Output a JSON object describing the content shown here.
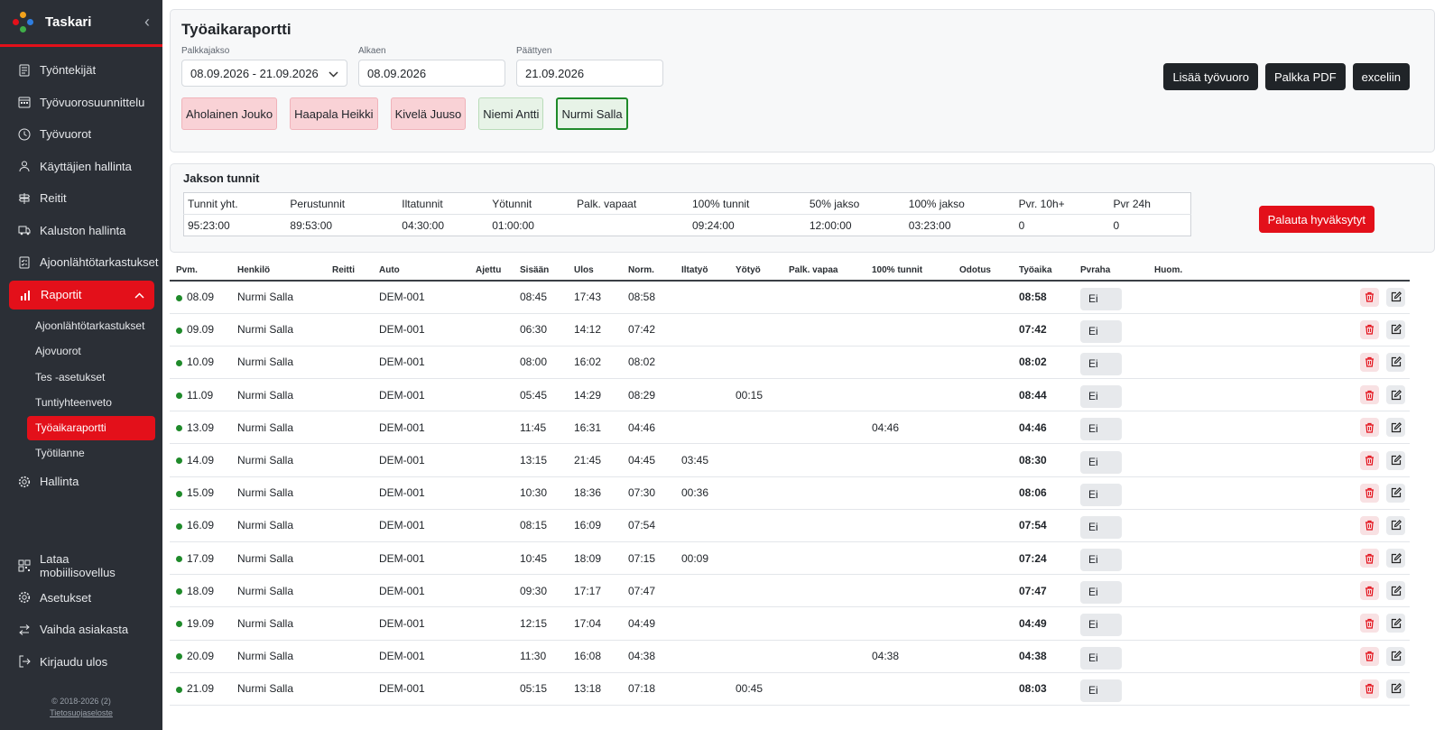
{
  "app": {
    "name": "Taskari"
  },
  "sidebar": {
    "items": [
      {
        "label": "Työntekijät",
        "icon": "id-card-icon"
      },
      {
        "label": "Työvuorosuunnittelu",
        "icon": "calendar-icon"
      },
      {
        "label": "Työvuorot",
        "icon": "clock-icon"
      },
      {
        "label": "Käyttäjien hallinta",
        "icon": "users-icon"
      },
      {
        "label": "Reitit",
        "icon": "signpost-icon"
      },
      {
        "label": "Kaluston hallinta",
        "icon": "truck-icon"
      },
      {
        "label": "Ajoonlähtötarkastukset",
        "icon": "list-check-icon"
      },
      {
        "label": "Raportit",
        "icon": "bar-chart-icon"
      }
    ],
    "sub_items": [
      "Ajoonlähtötarkastukset",
      "Ajovuorot",
      "Tes -asetukset",
      "Tuntiyhteenveto",
      "Työaikaraportti",
      "Työtilanne"
    ],
    "after": [
      {
        "label": "Hallinta",
        "icon": "gear-icon"
      }
    ],
    "bottom": [
      {
        "label": "Lataa mobiilisovellus",
        "icon": "qr-code-icon"
      },
      {
        "label": "Asetukset",
        "icon": "gear-icon"
      },
      {
        "label": "Vaihda asiakasta",
        "icon": "swap-icon"
      },
      {
        "label": "Kirjaudu ulos",
        "icon": "logout-icon"
      }
    ],
    "footer_copyright": "© 2018-2026 (2)",
    "footer_link": "Tietosuojaseloste"
  },
  "report": {
    "title": "Työaikaraportti",
    "period_label": "Palkkajakso",
    "period_value": "08.09.2026 - 21.09.2026",
    "start_label": "Alkaen",
    "start_value": "08.09.2026",
    "end_label": "Päättyen",
    "end_value": "21.09.2026",
    "buttons": {
      "add_shift": "Lisää työvuoro",
      "pay_pdf": "Palkka PDF",
      "excel": "exceliin"
    },
    "persons": [
      {
        "name": "Aholainen Jouko",
        "status": "red"
      },
      {
        "name": "Haapala Heikki",
        "status": "red"
      },
      {
        "name": "Kivelä Juuso",
        "status": "red"
      },
      {
        "name": "Niemi Antti",
        "status": "green"
      },
      {
        "name": "Nurmi Salla",
        "status": "selected"
      }
    ]
  },
  "hours": {
    "title": "Jakson tunnit",
    "headers": [
      "Tunnit yht.",
      "Perustunnit",
      "Iltatunnit",
      "Yötunnit",
      "Palk. vapaat",
      "100% tunnit",
      "50% jakso",
      "100% jakso",
      "Pvr. 10h+",
      "Pvr 24h"
    ],
    "values": [
      "95:23:00",
      "89:53:00",
      "04:30:00",
      "01:00:00",
      "",
      "09:24:00",
      "12:00:00",
      "03:23:00",
      "0",
      "0"
    ],
    "restore_button": "Palauta hyväksytyt"
  },
  "shifts": {
    "headers": [
      "Pvm.",
      "Henkilö",
      "Reitti",
      "Auto",
      "Ajettu",
      "Sisään",
      "Ulos",
      "Norm.",
      "Iltatyö",
      "Yötyö",
      "Palk. vapaa",
      "100% tunnit",
      "Odotus",
      "Työaika",
      "Pvraha",
      "Huom."
    ],
    "rows": [
      {
        "date": "08.09",
        "person": "Nurmi Salla",
        "route": "",
        "car": "DEM-001",
        "driven": "",
        "in": "08:45",
        "out": "17:43",
        "norm": "08:58",
        "evening": "",
        "night": "",
        "paid_off": "",
        "h100": "",
        "wait": "",
        "worktime": "08:58",
        "pvr": "Ei",
        "note": ""
      },
      {
        "date": "09.09",
        "person": "Nurmi Salla",
        "route": "",
        "car": "DEM-001",
        "driven": "",
        "in": "06:30",
        "out": "14:12",
        "norm": "07:42",
        "evening": "",
        "night": "",
        "paid_off": "",
        "h100": "",
        "wait": "",
        "worktime": "07:42",
        "pvr": "Ei",
        "note": ""
      },
      {
        "date": "10.09",
        "person": "Nurmi Salla",
        "route": "",
        "car": "DEM-001",
        "driven": "",
        "in": "08:00",
        "out": "16:02",
        "norm": "08:02",
        "evening": "",
        "night": "",
        "paid_off": "",
        "h100": "",
        "wait": "",
        "worktime": "08:02",
        "pvr": "Ei",
        "note": ""
      },
      {
        "date": "11.09",
        "person": "Nurmi Salla",
        "route": "",
        "car": "DEM-001",
        "driven": "",
        "in": "05:45",
        "out": "14:29",
        "norm": "08:29",
        "evening": "",
        "night": "00:15",
        "paid_off": "",
        "h100": "",
        "wait": "",
        "worktime": "08:44",
        "pvr": "Ei",
        "note": ""
      },
      {
        "date": "13.09",
        "person": "Nurmi Salla",
        "route": "",
        "car": "DEM-001",
        "driven": "",
        "in": "11:45",
        "out": "16:31",
        "norm": "04:46",
        "evening": "",
        "night": "",
        "paid_off": "",
        "h100": "04:46",
        "wait": "",
        "worktime": "04:46",
        "pvr": "Ei",
        "note": ""
      },
      {
        "date": "14.09",
        "person": "Nurmi Salla",
        "route": "",
        "car": "DEM-001",
        "driven": "",
        "in": "13:15",
        "out": "21:45",
        "norm": "04:45",
        "evening": "03:45",
        "night": "",
        "paid_off": "",
        "h100": "",
        "wait": "",
        "worktime": "08:30",
        "pvr": "Ei",
        "note": ""
      },
      {
        "date": "15.09",
        "person": "Nurmi Salla",
        "route": "",
        "car": "DEM-001",
        "driven": "",
        "in": "10:30",
        "out": "18:36",
        "norm": "07:30",
        "evening": "00:36",
        "night": "",
        "paid_off": "",
        "h100": "",
        "wait": "",
        "worktime": "08:06",
        "pvr": "Ei",
        "note": ""
      },
      {
        "date": "16.09",
        "person": "Nurmi Salla",
        "route": "",
        "car": "DEM-001",
        "driven": "",
        "in": "08:15",
        "out": "16:09",
        "norm": "07:54",
        "evening": "",
        "night": "",
        "paid_off": "",
        "h100": "",
        "wait": "",
        "worktime": "07:54",
        "pvr": "Ei",
        "note": ""
      },
      {
        "date": "17.09",
        "person": "Nurmi Salla",
        "route": "",
        "car": "DEM-001",
        "driven": "",
        "in": "10:45",
        "out": "18:09",
        "norm": "07:15",
        "evening": "00:09",
        "night": "",
        "paid_off": "",
        "h100": "",
        "wait": "",
        "worktime": "07:24",
        "pvr": "Ei",
        "note": ""
      },
      {
        "date": "18.09",
        "person": "Nurmi Salla",
        "route": "",
        "car": "DEM-001",
        "driven": "",
        "in": "09:30",
        "out": "17:17",
        "norm": "07:47",
        "evening": "",
        "night": "",
        "paid_off": "",
        "h100": "",
        "wait": "",
        "worktime": "07:47",
        "pvr": "Ei",
        "note": ""
      },
      {
        "date": "19.09",
        "person": "Nurmi Salla",
        "route": "",
        "car": "DEM-001",
        "driven": "",
        "in": "12:15",
        "out": "17:04",
        "norm": "04:49",
        "evening": "",
        "night": "",
        "paid_off": "",
        "h100": "",
        "wait": "",
        "worktime": "04:49",
        "pvr": "Ei",
        "note": ""
      },
      {
        "date": "20.09",
        "person": "Nurmi Salla",
        "route": "",
        "car": "DEM-001",
        "driven": "",
        "in": "11:30",
        "out": "16:08",
        "norm": "04:38",
        "evening": "",
        "night": "",
        "paid_off": "",
        "h100": "04:38",
        "wait": "",
        "worktime": "04:38",
        "pvr": "Ei",
        "note": ""
      },
      {
        "date": "21.09",
        "person": "Nurmi Salla",
        "route": "",
        "car": "DEM-001",
        "driven": "",
        "in": "05:15",
        "out": "13:18",
        "norm": "07:18",
        "evening": "",
        "night": "00:45",
        "paid_off": "",
        "h100": "",
        "wait": "",
        "worktime": "08:03",
        "pvr": "Ei",
        "note": ""
      }
    ]
  },
  "colors": {
    "accent": "#e3101a",
    "sidebar_bg": "#2b2f36",
    "status_ok": "#1f8a2a"
  }
}
